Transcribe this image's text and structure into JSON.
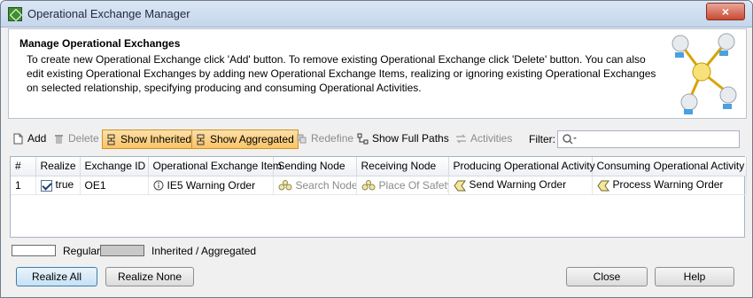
{
  "window": {
    "title": "Operational Exchange Manager",
    "close_label": "×"
  },
  "header": {
    "title": "Manage Operational Exchanges",
    "description": "To create new Operational Exchange click 'Add' button. To remove existing Operational Exchange click 'Delete' button. You can also edit existing Operational Exchanges by adding new Operational Exchange Items, realizing or ignoring existing Operational Exchanges on selected relationship, specifying producing and consuming Operational Activities."
  },
  "toolbar": {
    "add": "Add",
    "delete": "Delete",
    "show_inherited": "Show Inherited",
    "show_aggregated": "Show Aggregated",
    "redefine": "Redefine",
    "show_full_paths": "Show Full Paths",
    "activities": "Activities",
    "filter_label": "Filter:",
    "filter_value": ""
  },
  "table": {
    "columns": [
      "#",
      "Realize",
      "Exchange ID",
      "Operational Exchange Item",
      "Sending Node",
      "Receiving Node",
      "Producing Operational Activity",
      "Consuming Operational Activity"
    ],
    "rows": [
      {
        "num": "1",
        "realize": "true",
        "realize_checked": true,
        "exchange_id": "OE1",
        "item": "IE5 Warning Order",
        "sending_node": "Search Node",
        "receiving_node": "Place Of Safety",
        "producing_activity": "Send Warning Order",
        "consuming_activity": "Process Warning Order"
      }
    ]
  },
  "legend": {
    "regular": "Regular",
    "inherited": "Inherited / Aggregated"
  },
  "buttons": {
    "realize_all": "Realize All",
    "realize_none": "Realize None",
    "close": "Close",
    "help": "Help"
  },
  "colors": {
    "toggle_bg": "#f9c467",
    "inherited_text": "#8a8a8a",
    "legend_inherited": "#c8c8c8"
  }
}
